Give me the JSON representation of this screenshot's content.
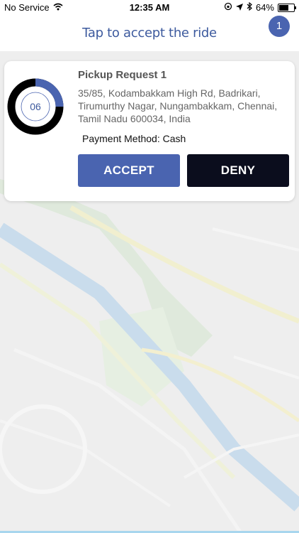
{
  "status_bar": {
    "carrier": "No Service",
    "time": "12:35 AM",
    "battery": "64%",
    "battery_level": 0.64
  },
  "header": {
    "title": "Tap to accept the ride",
    "badge_count": "1"
  },
  "request": {
    "title": "Pickup Request 1",
    "address": "35/85, Kodambakkam High Rd, Badrikari, Tirumurthy Nagar, Nungambakkam, Chennai, Tamil Nadu 600034, India",
    "payment": "Payment Method: Cash",
    "timer_value": "06",
    "timer_progress": 0.25
  },
  "buttons": {
    "accept": "ACCEPT",
    "deny": "DENY"
  },
  "colors": {
    "accent": "#4a64b0",
    "deny": "#0b0d1d",
    "title_blue": "#3d5a9e"
  }
}
